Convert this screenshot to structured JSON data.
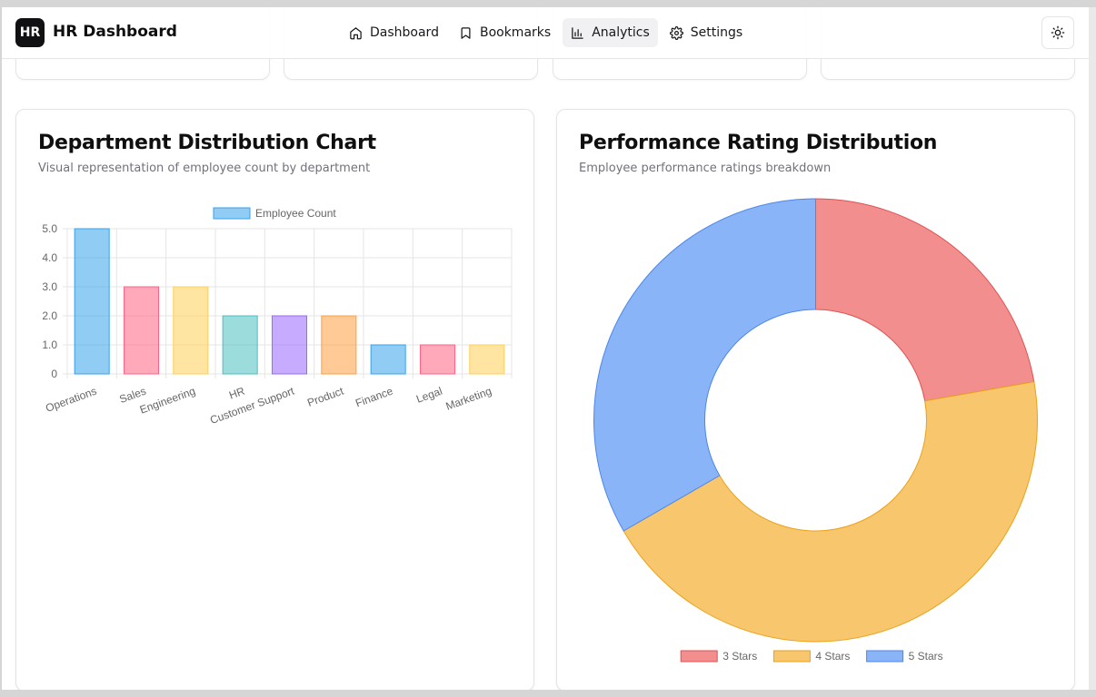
{
  "header": {
    "logo_text": "HR",
    "app_title": "HR Dashboard",
    "nav": [
      {
        "label": "Dashboard",
        "icon": "home-icon",
        "active": false
      },
      {
        "label": "Bookmarks",
        "icon": "bookmark-icon",
        "active": false
      },
      {
        "label": "Analytics",
        "icon": "bar-chart-icon",
        "active": true
      },
      {
        "label": "Settings",
        "icon": "gear-icon",
        "active": false
      }
    ],
    "theme_toggle_icon": "sun-icon"
  },
  "department_card": {
    "title": "Department Distribution Chart",
    "subtitle": "Visual representation of employee count by department"
  },
  "performance_card": {
    "title": "Performance Rating Distribution",
    "subtitle": "Employee performance ratings breakdown"
  },
  "chart_data": [
    {
      "type": "bar",
      "legend": [
        "Employee Count"
      ],
      "categories": [
        "Operations",
        "Sales",
        "Engineering",
        "HR",
        "Customer Support",
        "Product",
        "Finance",
        "Legal",
        "Marketing"
      ],
      "series": [
        {
          "name": "Employee Count",
          "values": [
            5,
            3,
            3,
            2,
            2,
            2,
            1,
            1,
            1
          ]
        }
      ],
      "ylim": [
        0,
        5
      ],
      "yticks": [
        "0",
        "1.0",
        "2.0",
        "3.0",
        "4.0",
        "5.0"
      ],
      "grid": true,
      "legend_position": "top",
      "colors": [
        "#36a2eb",
        "#ff6384",
        "#ffce56",
        "#4bc0c0",
        "#9966ff",
        "#ff9f40",
        "#36a2eb",
        "#ff6384",
        "#ffce56"
      ]
    },
    {
      "type": "pie",
      "donut": true,
      "labels": [
        "3 Stars",
        "4 Stars",
        "5 Stars"
      ],
      "values": [
        2,
        4,
        3
      ],
      "colors": [
        "#f28e8e",
        "#f8c66c",
        "#8ab4f8"
      ],
      "border_colors": [
        "#e05252",
        "#eaa21a",
        "#4d86e8"
      ],
      "legend_position": "bottom"
    }
  ]
}
